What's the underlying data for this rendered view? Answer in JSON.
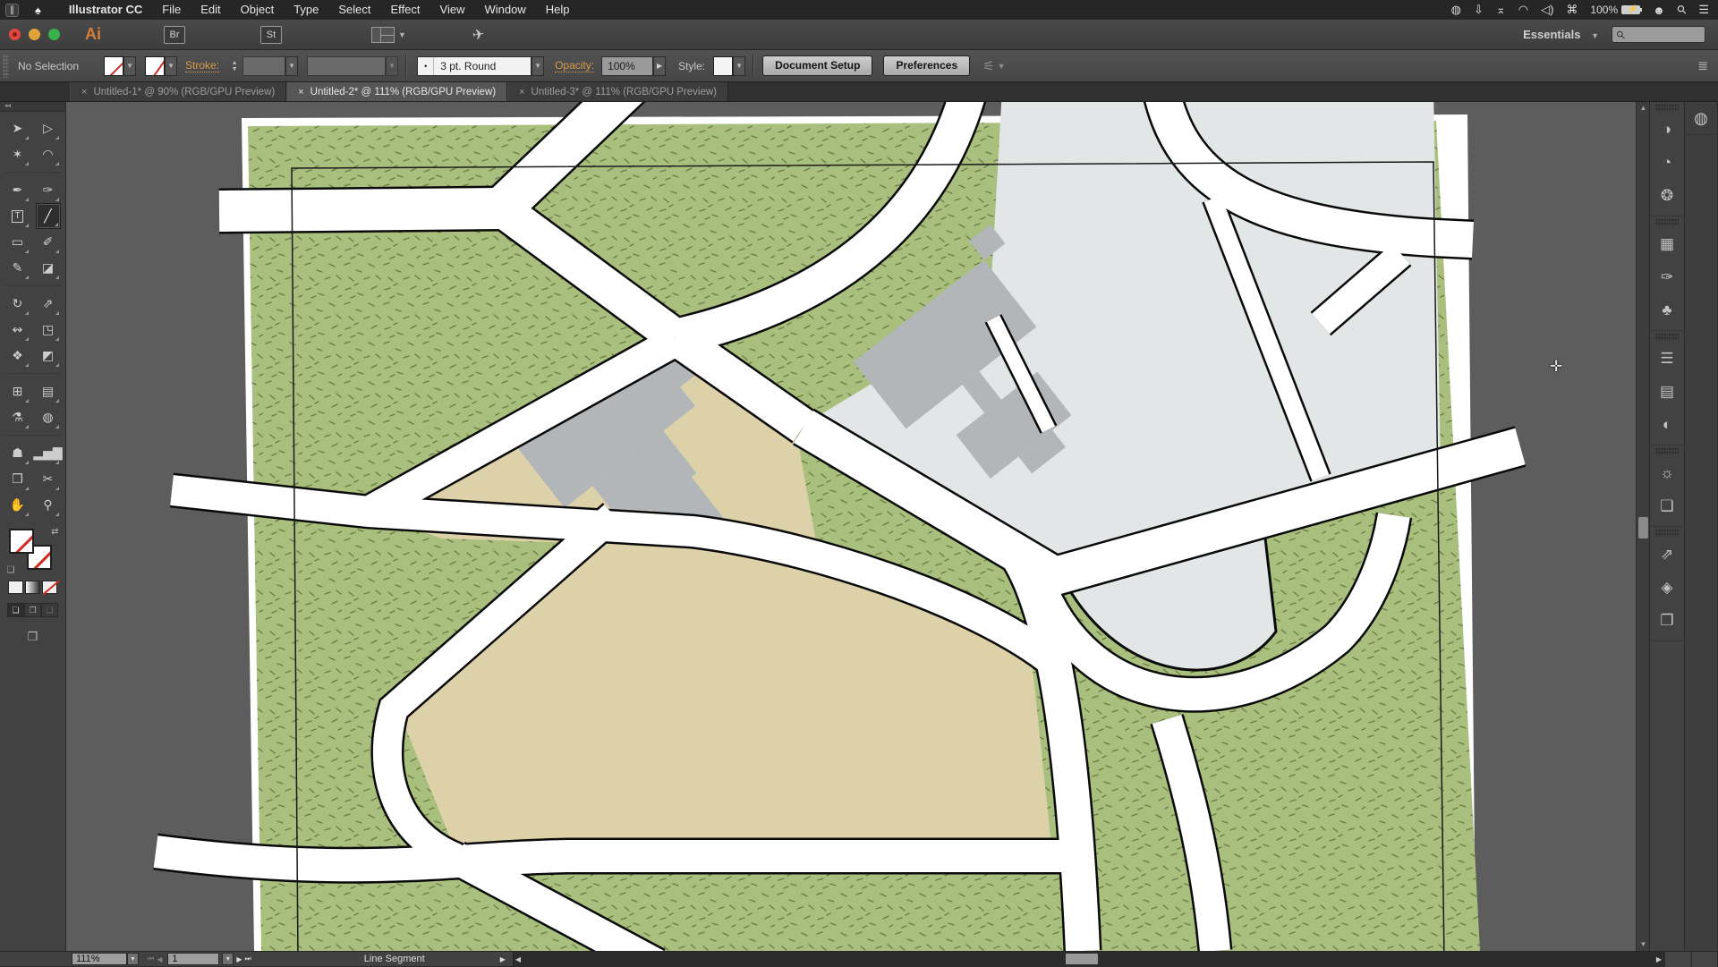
{
  "menu_bar": {
    "parallels_icon": "∥",
    "apple_icon": "♠",
    "app_name": "Illustrator CC",
    "menus": [
      "File",
      "Edit",
      "Object",
      "Type",
      "Select",
      "Effect",
      "View",
      "Window",
      "Help"
    ],
    "status_icons": [
      {
        "name": "creative-cloud-icon",
        "glyph": "◍"
      },
      {
        "name": "parallels-actions-icon",
        "glyph": "⇩"
      },
      {
        "name": "airplay-icon",
        "glyph": "⌅"
      },
      {
        "name": "wifi-icon",
        "glyph": "◠"
      },
      {
        "name": "volume-icon",
        "glyph": "◁)"
      },
      {
        "name": "keyboard-icon",
        "glyph": "⌘"
      }
    ],
    "battery_percent": "100%",
    "battery_bolt": "⚡",
    "user_icon": "☻",
    "spotlight_icon": "⚲",
    "list_icon": "☰"
  },
  "title_bar": {
    "ai_logo": "Ai",
    "bridge_button": "Br",
    "stock_button": "St",
    "gpu_icon": "✈",
    "workspace": "Essentials",
    "workspace_caret": "▼",
    "search_placeholder": ""
  },
  "control_bar": {
    "selection_status": "No Selection",
    "stroke_label": "Stroke:",
    "brush_name": "3 pt. Round",
    "brush_dot": "•",
    "opacity_label": "Opacity:",
    "opacity_value": "100%",
    "style_label": "Style:",
    "document_setup_label": "Document Setup",
    "preferences_label": "Preferences",
    "panel_menu_glyph": "≣"
  },
  "tabs": [
    {
      "label": "Untitled-1* @ 90% (RGB/GPU Preview)",
      "active": false
    },
    {
      "label": "Untitled-2* @ 111% (RGB/GPU Preview)",
      "active": true
    },
    {
      "label": "Untitled-3* @ 111% (RGB/GPU Preview)",
      "active": false
    }
  ],
  "tools": [
    {
      "name": "selection-tool",
      "glyph": "➤"
    },
    {
      "name": "direct-selection-tool",
      "glyph": "▷"
    },
    {
      "name": "magic-wand-tool",
      "glyph": "✶"
    },
    {
      "name": "lasso-tool",
      "glyph": "◠"
    },
    {
      "sep": true
    },
    {
      "name": "pen-tool",
      "glyph": "✒"
    },
    {
      "name": "curvature-tool",
      "glyph": "✑"
    },
    {
      "name": "type-tool",
      "glyph": "T",
      "boxed": true
    },
    {
      "name": "line-segment-tool",
      "glyph": "╱",
      "active": true
    },
    {
      "name": "rectangle-tool",
      "glyph": "▭"
    },
    {
      "name": "paintbrush-tool",
      "glyph": "✐"
    },
    {
      "name": "pencil-tool",
      "glyph": "✎"
    },
    {
      "name": "eraser-tool",
      "glyph": "◪"
    },
    {
      "sep": true
    },
    {
      "name": "rotate-tool",
      "glyph": "↻"
    },
    {
      "name": "scale-tool",
      "glyph": "⇗"
    },
    {
      "name": "width-tool",
      "glyph": "↭"
    },
    {
      "name": "free-transform-tool",
      "glyph": "◳"
    },
    {
      "name": "shape-builder-tool",
      "glyph": "❖"
    },
    {
      "name": "perspective-grid-tool",
      "glyph": "◩"
    },
    {
      "sep": true
    },
    {
      "name": "mesh-tool",
      "glyph": "⊞"
    },
    {
      "name": "gradient-tool",
      "glyph": "▤"
    },
    {
      "name": "eyedropper-tool",
      "glyph": "⚗"
    },
    {
      "name": "blend-tool",
      "glyph": "◍"
    },
    {
      "sep": true
    },
    {
      "name": "symbol-sprayer-tool",
      "glyph": "☗"
    },
    {
      "name": "column-graph-tool",
      "glyph": "▂▅▇"
    },
    {
      "name": "artboard-tool",
      "glyph": "❒"
    },
    {
      "name": "slice-tool",
      "glyph": "✂"
    },
    {
      "name": "hand-tool",
      "glyph": "✋"
    },
    {
      "name": "zoom-tool",
      "glyph": "⚲"
    }
  ],
  "dock": {
    "groups": [
      {
        "items": [
          {
            "name": "color-panel",
            "glyph": "◑"
          },
          {
            "name": "color-guide-panel",
            "glyph": "◔"
          },
          {
            "name": "color-themes-panel",
            "glyph": "❂"
          }
        ]
      },
      {
        "items": [
          {
            "name": "swatches-panel",
            "glyph": "▦"
          },
          {
            "name": "brushes-panel",
            "glyph": "✑"
          },
          {
            "name": "symbols-panel",
            "glyph": "♣"
          }
        ]
      },
      {
        "items": [
          {
            "name": "stroke-panel",
            "glyph": "☰"
          },
          {
            "name": "gradient-panel",
            "glyph": "▤"
          },
          {
            "name": "transparency-panel",
            "glyph": "◐"
          }
        ]
      },
      {
        "items": [
          {
            "name": "appearance-panel",
            "glyph": "☼"
          },
          {
            "name": "graphic-styles-panel",
            "glyph": "❏"
          }
        ]
      },
      {
        "items": [
          {
            "name": "export-panel",
            "glyph": "⇗"
          },
          {
            "name": "layers-panel",
            "glyph": "◈"
          },
          {
            "name": "artboards-panel",
            "glyph": "❐"
          }
        ]
      }
    ],
    "libraries_glyph": "◍"
  },
  "status_bar": {
    "zoom_value": "111%",
    "artboard_value": "1",
    "status_text": "Line Segment"
  },
  "colors": {
    "pasteboard": "#5d5d5d",
    "artboard": "#ffffff",
    "grass": "#a9bf7d",
    "grass_dash": "#6b7d46",
    "parcel_tan": "#ddd1a9",
    "campus_gray": "#e3e6e6",
    "building_gray": "#b2b6b9",
    "road_fill": "#ffffff",
    "road_casing": "#0a0a0a",
    "frame_line": "#1a1a1a",
    "link_orange": "#d79b4a"
  }
}
